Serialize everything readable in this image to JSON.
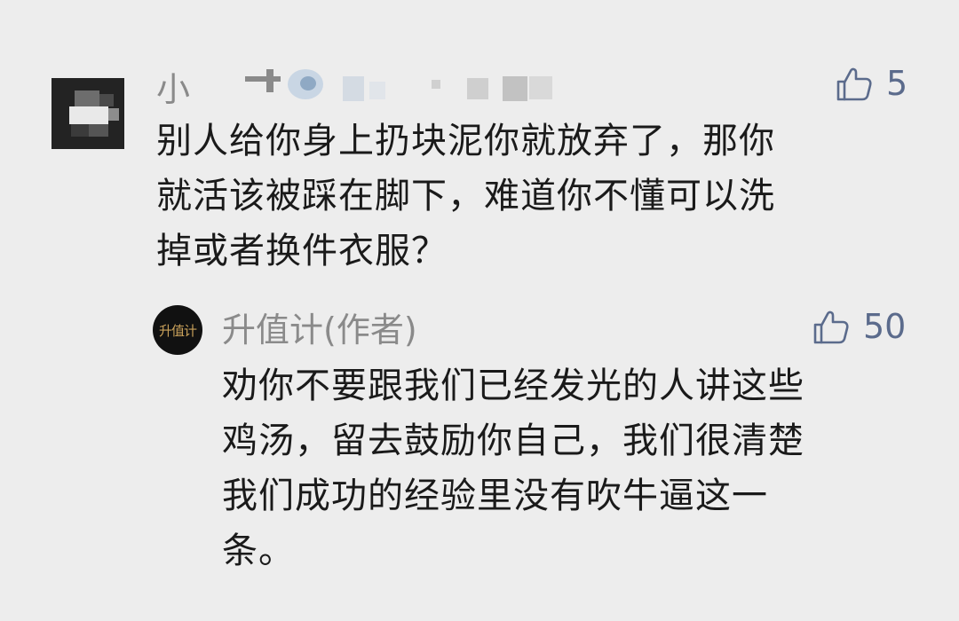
{
  "main_comment": {
    "author_visible": "小",
    "likes": "5",
    "text_lines": [
      "别人给你身上扔块泥你就放弃了，那你",
      "就活该被踩在脚下，难道你不懂可以洗",
      "掉或者换件衣服？"
    ],
    "icons": {
      "avatar": "blurred-avatar",
      "like": "thumbs-up-icon"
    }
  },
  "reply": {
    "author": "升值计(作者)",
    "avatar_text": "升值计",
    "likes": "50",
    "text_lines": [
      "劝你不要跟我们已经发光的人讲这些",
      "鸡汤，留去鼓励你自己，我们很清楚",
      "我们成功的经验里没有吹牛逼这一",
      "条。"
    ],
    "icons": {
      "avatar": "logo-avatar",
      "like": "thumbs-up-icon"
    }
  },
  "colors": {
    "background": "#ededed",
    "text": "#1a1a1a",
    "name": "#8a8a8a",
    "like": "#5b6b8c",
    "avatar_gold": "#c9a15a"
  }
}
